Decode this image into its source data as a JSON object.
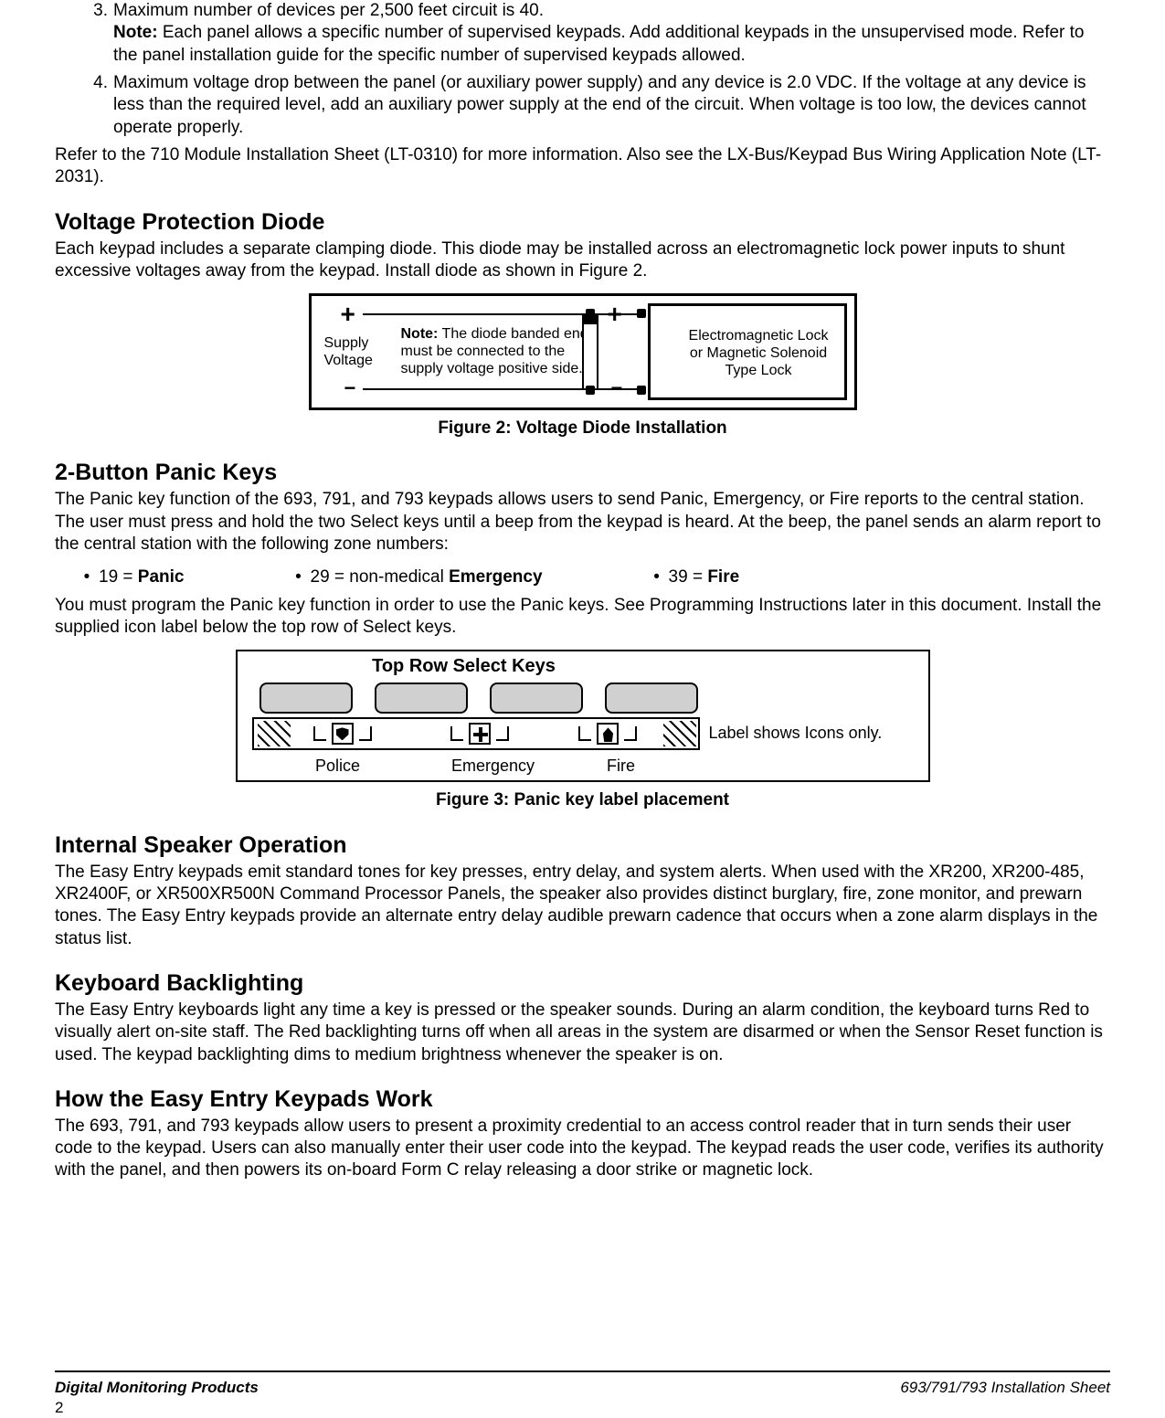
{
  "list3": {
    "num": "3.",
    "line1": "Maximum number of devices per 2,500 feet circuit is 40.",
    "note_label": "Note:",
    "note_body": "Each panel allows a specific number of supervised keypads.  Add additional keypads in the unsupervised mode.  Refer to the panel installation guide for the specific number of supervised keypads allowed."
  },
  "list4": {
    "num": "4.",
    "body": "Maximum voltage drop between the panel (or auxiliary power supply) and any device is 2.0 VDC.  If the voltage at any device is less than the required level, add an auxiliary power supply at the end of the circuit.  When voltage is too low, the devices cannot operate properly."
  },
  "refer_para": "Refer to the 710 Module Installation Sheet (LT-0310) for more information.  Also see the LX-Bus/Keypad Bus Wiring Application Note (LT-2031).",
  "vpd": {
    "heading": "Voltage Protection Diode",
    "body": "Each keypad includes a separate clamping diode.  This diode may be installed across an electromagnetic lock power inputs to shunt excessive voltages away from the keypad.  Install diode as shown in Figure 2."
  },
  "fig2": {
    "plus": "+",
    "minus": "−",
    "supply_l1": "Supply",
    "supply_l2": "Voltage",
    "note_label": "Note:",
    "note_body": "The diode banded end must be connected to the supply voltage positive side.",
    "lock_l1": "Electromagnetic Lock",
    "lock_l2": "or Magnetic Solenoid",
    "lock_l3": "Type Lock",
    "caption": "Figure 2: Voltage Diode Installation"
  },
  "panic": {
    "heading": "2-Button Panic Keys",
    "body": "The Panic key function of the 693, 791, and 793 keypads allows users to send Panic, Emergency, or Fire reports to the central station.  The user must press and hold the two Select keys until a beep from the keypad is heard.  At the beep, the panel sends an alarm report to the central station with the following zone numbers:",
    "items": {
      "i1_pre": "19 = ",
      "i1_strong": "Panic",
      "i2_pre": "29 = non-medical ",
      "i2_strong": "Emergency",
      "i3_pre": "39 = ",
      "i3_strong": "Fire"
    },
    "after": "You must program the Panic key function in order to use the Panic keys.  See Programming Instructions later in this document.  Install the supplied icon label below the top row of Select keys."
  },
  "fig3": {
    "title": "Top Row Select Keys",
    "police": "Police",
    "emergency": "Emergency",
    "fire": "Fire",
    "right_label": "Label shows Icons only.",
    "caption": "Figure 3: Panic key label placement"
  },
  "speaker": {
    "heading": "Internal Speaker Operation",
    "body": "The Easy Entry keypads emit standard tones for key presses, entry delay, and system alerts.  When used with the XR200, XR200-485, XR2400F, or XR500XR500N Command Processor Panels, the speaker also provides distinct burglary, fire, zone monitor, and prewarn tones.  The Easy Entry keypads provide an alternate entry delay audible prewarn cadence that occurs when a zone alarm displays in the status list."
  },
  "backlight": {
    "heading": "Keyboard Backlighting",
    "body": "The Easy Entry keyboards light any time a key is pressed or the speaker sounds.  During an alarm condition, the keyboard turns Red to visually alert on-site staff.  The Red backlighting turns off when all areas in the system are disarmed or when the Sensor Reset function is used.  The keypad backlighting dims to medium brightness whenever the speaker is on."
  },
  "how": {
    "heading": "How the Easy Entry Keypads Work",
    "body": "The 693, 791, and 793 keypads allow users to present a proximity credential to an access control reader that in turn sends their user code to the keypad.  Users can also manually enter their user code into the keypad.  The keypad reads the user code, verifies its authority with the panel, and then powers its on-board Form C relay releasing a door strike or magnetic lock."
  },
  "footer": {
    "left": "Digital Monitoring Products",
    "right": "693/791/793 Installation Sheet",
    "page": "2"
  }
}
